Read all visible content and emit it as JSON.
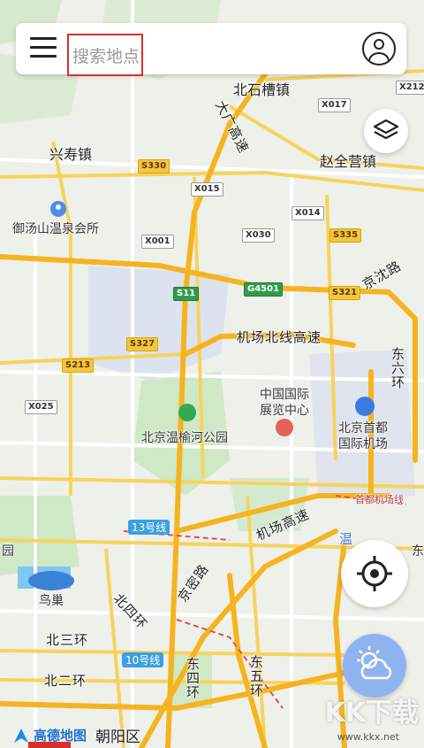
{
  "search": {
    "placeholder": "搜索地点"
  },
  "map": {
    "places": {
      "beishicaozhen": "北石槽镇",
      "xingshouzhen": "兴寿镇",
      "zhaoquanyingzhen": "赵全营镇",
      "yutangshan": "御汤山温泉会所",
      "zhongguoguoji": "中国国际",
      "zhanlanzhongxin": "展览中心",
      "wenyuhe": "北京温榆河公园",
      "beijingshoudu": "北京首都",
      "guojijichang": "国际机场",
      "niaochao": "鸟巢",
      "chaoyang": "朝阳区",
      "yuan": "园",
      "dong": "东"
    },
    "roads": {
      "daguang": "大广高速",
      "jingshen": "京沈路",
      "jichangbeixian": "机场北线高速",
      "dongliuhuan": "东六环",
      "jichanggaosu": "机场高速",
      "jingmilu": "京密路",
      "beisihuan": "北四环",
      "beisanhuan": "北三环",
      "beierhuan": "北二环",
      "dongsihuan": "东四环",
      "dongwuhuan": "东五环",
      "wen": "温",
      "shoudujichangxian": "首都机场线",
      "line13": "13号线",
      "line10": "10号线"
    },
    "badges": {
      "x212": "X212",
      "x017": "X017",
      "s330": "S330",
      "x015": "X015",
      "x014": "X014",
      "x001": "X001",
      "x030": "X030",
      "s335": "S335",
      "s11": "S11",
      "g4501": "G4501",
      "s321": "S321",
      "s327": "S327",
      "s213": "S213",
      "x025": "X025"
    }
  },
  "branding": {
    "logo_text": "高德地图",
    "watermark": "KK下载",
    "watermark_url": "www.kkx.net"
  },
  "icons": {
    "menu": "menu-icon",
    "user": "user-icon",
    "layers": "layers-icon",
    "locate": "crosshair-icon",
    "weather": "weather-icon",
    "location_arrow": "navigation-arrow-icon"
  }
}
